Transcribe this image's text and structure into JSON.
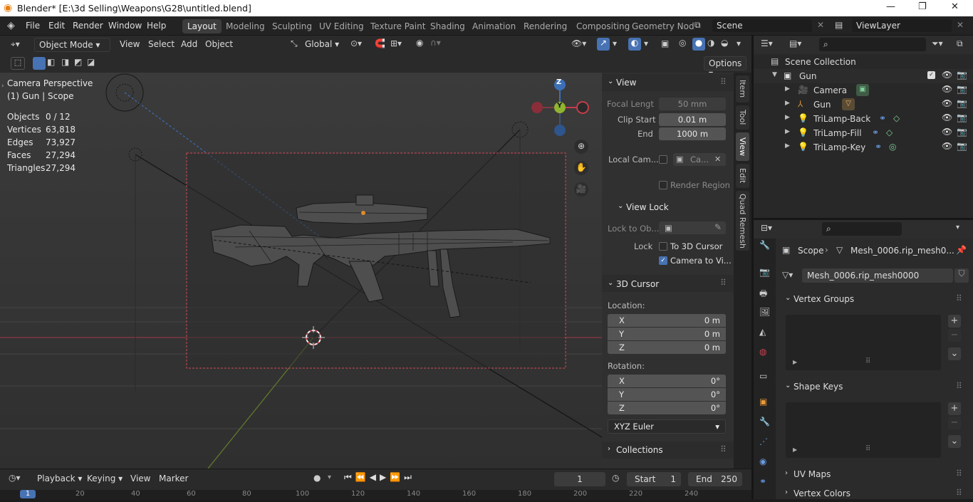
{
  "window": {
    "title": "Blender* [E:\\3d Selling\\Weapons\\G28\\untitled.blend]",
    "min": "—",
    "restore": "❐",
    "close": "✕"
  },
  "menu": [
    "File",
    "Edit",
    "Render",
    "Window",
    "Help"
  ],
  "workspaces": [
    "Layout",
    "Modeling",
    "Sculpting",
    "UV Editing",
    "Texture Paint",
    "Shading",
    "Animation",
    "Rendering",
    "Compositing",
    "Geometry Nod"
  ],
  "scene": {
    "scene_name": "Scene",
    "view_layer": "ViewLayer"
  },
  "header3d": {
    "mode": "Object Mode",
    "menus": [
      "View",
      "Select",
      "Add",
      "Object"
    ],
    "orientation": "Global"
  },
  "toolbar": {
    "options": "Options"
  },
  "viewport": {
    "title": "Camera Perspective",
    "subtitle": "(1) Gun | Scope",
    "stats": [
      {
        "label": "Objects",
        "value": "0 / 12"
      },
      {
        "label": "Vertices",
        "value": "63,818"
      },
      {
        "label": "Edges",
        "value": "73,927"
      },
      {
        "label": "Faces",
        "value": "27,294"
      },
      {
        "label": "Triangles",
        "value": "27,294"
      }
    ],
    "gizmo": {
      "z": "Z",
      "y": "Y"
    }
  },
  "npanel": {
    "view_header": "View",
    "focal_label": "Focal Lengt",
    "focal_value": "50 mm",
    "clip_start_label": "Clip Start",
    "clip_start_value": "0.01 m",
    "clip_end_label": "End",
    "clip_end_value": "1000 m",
    "local_cam_label": "Local Cam...",
    "local_cam_value": "Ca...",
    "render_region": "Render Region",
    "view_lock_header": "View Lock",
    "lock_to_ob_label": "Lock to Ob...",
    "lock_label": "Lock",
    "to_3d_cursor": "To 3D Cursor",
    "camera_to_view": "Camera to Vi...",
    "cursor_header": "3D Cursor",
    "location_label": "Location:",
    "loc": [
      {
        "axis": "X",
        "value": "0 m"
      },
      {
        "axis": "Y",
        "value": "0 m"
      },
      {
        "axis": "Z",
        "value": "0 m"
      }
    ],
    "rotation_label": "Rotation:",
    "rot": [
      {
        "axis": "X",
        "value": "0°"
      },
      {
        "axis": "Y",
        "value": "0°"
      },
      {
        "axis": "Z",
        "value": "0°"
      }
    ],
    "rotation_mode": "XYZ Euler",
    "collections_header": "Collections",
    "tabs": [
      "Item",
      "Tool",
      "View",
      "Edit",
      "Quad Remesh"
    ]
  },
  "timeline": {
    "menus": [
      "Playback",
      "Keying",
      "View",
      "Marker"
    ],
    "current_frame": "1",
    "start_label": "Start",
    "start_value": "1",
    "end_label": "End",
    "end_value": "250",
    "ruler": [
      "1",
      "20",
      "40",
      "60",
      "80",
      "100",
      "120",
      "140",
      "160",
      "180",
      "200",
      "220",
      "240"
    ]
  },
  "outliner": {
    "root": "Scene Collection",
    "collection": "Gun",
    "items": [
      "Camera",
      "Gun",
      "TriLamp-Back",
      "TriLamp-Fill",
      "TriLamp-Key"
    ]
  },
  "properties": {
    "breadcrumb_object": "Scope",
    "breadcrumb_mesh": "Mesh_0006.rip_mesh0...",
    "mesh_name": "Mesh_0006.rip_mesh0000",
    "sections": [
      "Vertex Groups",
      "Shape Keys",
      "UV Maps",
      "Vertex Colors"
    ]
  },
  "colors": {
    "accent": "#4772b3",
    "x_axis": "#c43c4a",
    "y_axis": "#7fa12f",
    "z_axis": "#3c6fb8"
  }
}
